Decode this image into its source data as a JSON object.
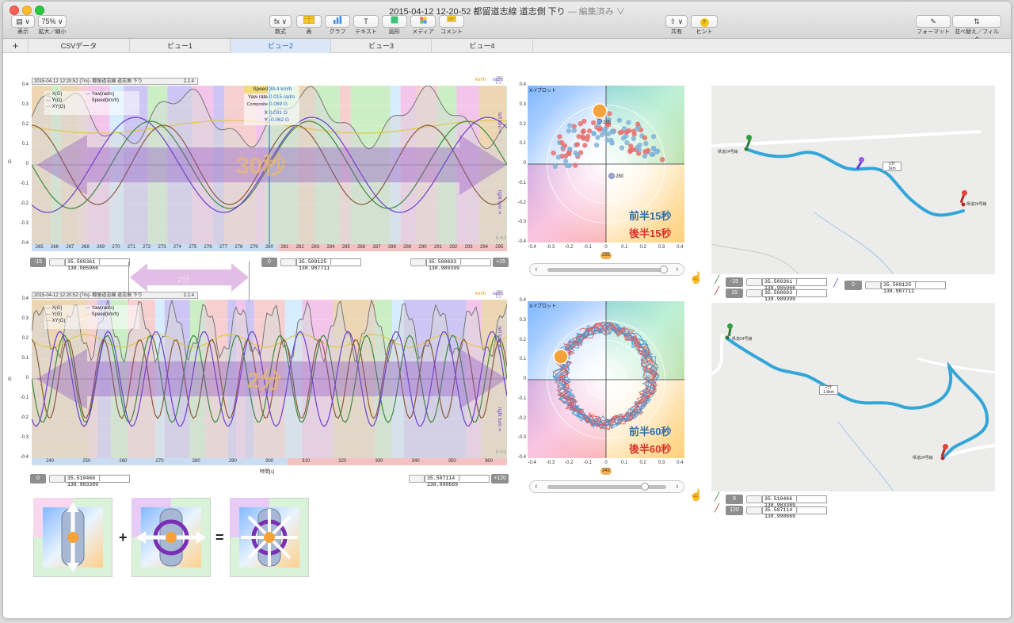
{
  "window": {
    "title": "2015-04-12 12-20-52 都留道志線 道志側 下り",
    "edited": "— 編集済み ∨"
  },
  "toolbar": {
    "view_label": "表示",
    "zoom_value": "75%",
    "zoom_label": "拡大／縮小",
    "formula_label": "数式",
    "table_label": "表",
    "chart_label": "グラフ",
    "text_label": "テキスト",
    "shape_label": "図形",
    "media_label": "メディア",
    "comment_label": "コメント",
    "share_label": "共有",
    "hint_label": "ヒント",
    "format_label": "フォーマット",
    "sort_label": "並べ替え／フィルタ",
    "formula_icon": "fx ∨",
    "hint_icon": "?"
  },
  "tabs": {
    "add": "+",
    "items": [
      "CSVデータ",
      "ビュー1",
      "ビュー2",
      "ビュー3",
      "ビュー4"
    ]
  },
  "chart1": {
    "header_title": "2015-04-12 12:20:52 (7m)- 都留道志線 道志側 下り",
    "header_version": "2.2.4",
    "unit_left": "km/h",
    "unit_right": "rad/s",
    "right_top": "150  0.2",
    "right_bottom": "0  -0.2",
    "ylabel": "G",
    "yticks": [
      "0.4",
      "0.3",
      "0.2",
      "0.1",
      "0",
      "-0.1",
      "-0.2",
      "-0.3",
      "-0.4"
    ],
    "xticks": [
      "265",
      "266",
      "267",
      "268",
      "269",
      "270",
      "271",
      "272",
      "273",
      "274",
      "275",
      "276",
      "277",
      "278",
      "279",
      "280",
      "281",
      "282",
      "283",
      "284",
      "285",
      "286",
      "287",
      "288",
      "289",
      "290",
      "291",
      "292",
      "293",
      "294",
      "295"
    ],
    "legend": [
      "X(G)",
      "Y(G)",
      "XY(G)",
      "Yaw(rad/s)",
      "Speed(km/h)"
    ],
    "readout": [
      {
        "label": "Speed",
        "value": "39.4 km/h"
      },
      {
        "label": "Yaw rate",
        "value": "0.015 rad/s"
      },
      {
        "label": "Composite",
        "value": "0.069 G"
      },
      {
        "label": "X",
        "value": "0.031 G"
      },
      {
        "label": "Y",
        "value": "-0.062 G"
      }
    ],
    "big_label": "30秒",
    "left_turn": "left turn ⇒",
    "right_turn": "right turn ⇒",
    "tag_left": "-15",
    "coord_left": [
      "35.509361",
      "138.985966"
    ],
    "tag_mid": "0",
    "coord_mid": [
      "35.509125",
      "138.987711"
    ],
    "coord_right": [
      "35.508693",
      "138.989399"
    ],
    "tag_right": "+15"
  },
  "between": {
    "label": "2分"
  },
  "chart2": {
    "header_title": "2015-04-12 12:20:52 (7m)- 都留道志線 道志側 下り",
    "header_version": "2.2.4",
    "unit_left": "km/h",
    "unit_right": "rad/s",
    "right_top": "150  0.2",
    "right_bottom": "0  -0.2",
    "ylabel": "G",
    "xlabel": "時間[s]",
    "yticks": [
      "0.4",
      "0.3",
      "0.2",
      "0.1",
      "0",
      "-0.1",
      "-0.2",
      "-0.3",
      "-0.4"
    ],
    "xticks": [
      "240",
      "250",
      "260",
      "270",
      "280",
      "290",
      "300",
      "310",
      "320",
      "330",
      "340",
      "350",
      "360"
    ],
    "legend": [
      "X(G)",
      "Y(G)",
      "XY(G)",
      "Yaw(rad/s)",
      "Speed(km/h)"
    ],
    "big_label": "2分",
    "left_turn": "left turn ⇒",
    "right_turn": "right turn ⇒",
    "tag_left": "0",
    "coord_left": [
      "35.510466",
      "138.983389"
    ],
    "coord_right": [
      "35.507114",
      "138.990669"
    ],
    "tag_right": "+120"
  },
  "xy1": {
    "title": "X-Yプロット",
    "yticks": [
      "0.4",
      "0.3",
      "0.2",
      "0.1",
      "0",
      "-0.1",
      "-0.2",
      "-0.3",
      "-0.4"
    ],
    "xticks": [
      "-0.4",
      "-0.3",
      "-0.2",
      "-0.1",
      "0",
      "0.1",
      "0.2",
      "0.3",
      "0.4"
    ],
    "label_first": "前半15秒",
    "label_second": "後半15秒",
    "marker_a": "265",
    "marker_b": "280",
    "slider_value": "295",
    "prev": "‹",
    "next": "›"
  },
  "xy2": {
    "title": "X-Yプロット",
    "yticks": [
      "0.4",
      "0.3",
      "0.2",
      "0.1",
      "0",
      "-0.1",
      "-0.2",
      "-0.3",
      "-0.4"
    ],
    "xticks": [
      "-0.4",
      "-0.3",
      "-0.2",
      "-0.1",
      "0",
      "0.1",
      "0.2",
      "0.3",
      "0.4"
    ],
    "label_first": "前半60秒",
    "label_second": "後半60秒",
    "slider_value": "342",
    "prev": "‹",
    "next": "›"
  },
  "map1": {
    "road_label_start": "県道24号線",
    "road_label_end": "県道24号線",
    "car_label": "1分",
    "car_sub": "1km",
    "rows": [
      {
        "tag": "-15",
        "coord": [
          "35.509361",
          "138.985966"
        ]
      },
      {
        "tag": "15",
        "coord": [
          "35.508693",
          "138.989399"
        ]
      }
    ],
    "mid_tag": "0",
    "mid_coord": [
      "35.509125",
      "138.987711"
    ]
  },
  "map2": {
    "road_label_start": "県道24号線",
    "road_label_end": "県道24号線",
    "car_label": "2分",
    "car_sub": "1.6km",
    "rows": [
      {
        "tag": "0",
        "coord": [
          "35.510466",
          "138.983389"
        ]
      },
      {
        "tag": "120",
        "coord": [
          "35.507114",
          "138.990669"
        ]
      }
    ]
  },
  "diagram": {
    "plus": "+",
    "equals": "="
  },
  "colors": {
    "x_line": "#3c8a3c",
    "y_line": "#8a5a3a",
    "xy_line": "#9a9a9a",
    "yaw_line": "#6a3fd0",
    "speed_line": "#e0c84a",
    "route": "#33a6d8",
    "accent_blue": "#2966c5",
    "first_half": "#2a6fb0",
    "second_half": "#d8322a"
  }
}
